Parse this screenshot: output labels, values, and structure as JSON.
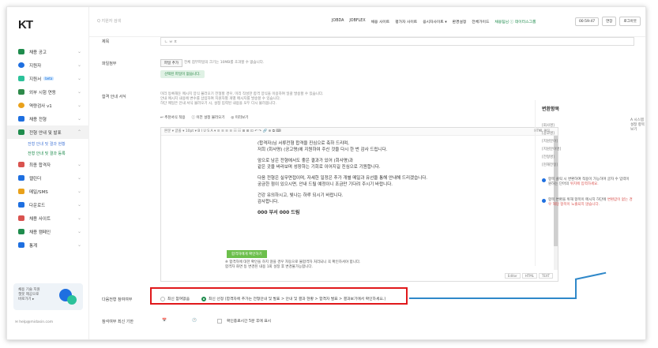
{
  "logo": "KT",
  "search": {
    "placeholder": "Q 지원자 검색"
  },
  "topnav": [
    "JOBDA",
    "JOBFLEX",
    "채용 사이트",
    "평가자 사이트",
    "응시자사이트 ▾",
    "환경설정",
    "전체가이드",
    "채용팀님 ⓘ 데이터스그룹"
  ],
  "top_right": {
    "timer": "00:59:47",
    "extend": "연장",
    "logout": "로그아웃"
  },
  "sidebar": {
    "items": [
      {
        "label": "채용 공고",
        "color": "#1f8c4d"
      },
      {
        "label": "지원자",
        "color": "#1e6fe0"
      },
      {
        "label": "지원서 ",
        "badge": "beta",
        "color": "#2cc29a"
      },
      {
        "label": "외부 시험 연동",
        "color": "#2e8a4a"
      },
      {
        "label": "역량검사 v1",
        "color": "#e9a11b"
      },
      {
        "label": "채용 전형",
        "color": "#1e6fe0"
      },
      {
        "label": "전형 안내 및 발표",
        "color": "#1f8c4d"
      },
      {
        "label": "최종 합격자",
        "color": "#d9534f"
      },
      {
        "label": "캘린더",
        "color": "#1e6fe0"
      },
      {
        "label": "메일/SMS",
        "color": "#e9a11b"
      },
      {
        "label": "다운로드",
        "color": "#1e6fe0"
      },
      {
        "label": "채용 사이트",
        "color": "#d9534f"
      },
      {
        "label": "채용 캠페인",
        "color": "#1f8c4d"
      },
      {
        "label": "통계",
        "color": "#1e6fe0"
      }
    ],
    "sub_items": [
      "전형 안내 및 결과 현황",
      "전형 안내 및 결과 등록"
    ],
    "promo": "채용 기술 지원\n챗봇 제공으로\n바로가기 ▸",
    "footer": "✉ help@midasin.com"
  },
  "form": {
    "title_label": "제목",
    "title_value": "ㄴ ㅂ ㅍ",
    "file_label": "파일첨부",
    "file_button": "파일 추가",
    "file_hint": "전체 첨부파일의 크기는 10MB를 초과할 수 없습니다.",
    "file_none": "선택된 파일이 없습니다.",
    "notice_label": "합격 안내 서식",
    "notice_hint1": "미리 등록해둔 메시지 양식 불러오기 전형할 경우, 미리 작성한 합격 양식을 이용하여 일괄 발송할 수 있습니다.",
    "notice_hint2": "안내 메시지 내용에 변수를 삽입하여 지원자별 개별 메시지를 발송할 수 있습니다.",
    "notice_hint3": "하단 메일은 안내 서식 불러오기 시, 설정 입력된 내용을 모두 다시 불러옵니다.",
    "tool_buttons": [
      "↩ 추천서식 적용",
      "ⓘ 이전 설정 불러오기",
      "◎ 미리보기"
    ],
    "system_setting": "A 시스템 설정 항목 보기",
    "editor_tools": "본문 ▾ 글꼴 ▾ 10pt ▾  B  I  U  S  A  ▾  ≡  ≡  ≡  ≡  ☷  ☷  ⊞  ⊞  ⊡  ↶  ↷  🔗  ⊕  ⧉  ⌨",
    "editor_html": "HTML 편집",
    "body_lines": [
      "(합격자)님 서류전형 합격을 진심으로 축하 드리며,",
      "저희 (회사명) (공고명)에 지원하여 주신 것을 다시 한 번 감사 드립니다.",
      "앞으로 남은 전형에서도 좋은 결과가 있어 (회사명)과",
      "같은 곳을 바라보며 성장하는 기회로 이어지길 진심으로 기원합니다.",
      "다음 전형은 실무면접이며, 자세한 일정은 추가 개별 메일과 유선을 통해 안내해 드리겠습니다.",
      "궁금한 점이 있으시면, 안내 드릴 예정이니 조금만 기다려 주시기 바랍니다.",
      "건강 유의하시고, 빛나는 하루 되시기 바랍니다.",
      "감사합니다."
    ],
    "signature": "000 부서 000 드림",
    "editor_footer": [
      "Editor",
      "HTML",
      "TEXT"
    ],
    "apply_button": "합격자에게 확인하기",
    "apply_note1": "※ 합격자에 대한 확인을 하지 않을 경우 자동으로 불합격자 처리되니 꼭 확인하셔야 합니다.",
    "apply_note2": "합격자 화면 등 변경된 내용 1회 설정 후 변경불가능합니다."
  },
  "right_panel": {
    "title": "변환항목",
    "items": [
      "[회사명]",
      "[공고명]",
      "[지원분야]",
      "[지원분야명]",
      "[전형명]",
      "[현재전형]"
    ],
    "note1_a": "항목 클릭 시 변환하여 적용이 가능하며 글자 수 입력이 원하는 단어의 ",
    "note1_b": "위치에 입력하세요.",
    "note2_a": "항목 변환을 위해 항목이 메시지 하단에 ",
    "note2_b": "변환값이 없는 경우 해당 항목이 노출되지 않습니다."
  },
  "next_step": {
    "label": "다음전형 참여여부",
    "opt1": "최신 참여없음",
    "opt2": "최신 선정 (합격자에 추가는 전형안내 및 발표 > 안내 및 결과 현황 > 합격자 발표 > 결과보기에서 확인하세요.)"
  },
  "deadline": {
    "label": "참석여부 최신 기한",
    "date_icon": "📅",
    "time_icon": "🕐",
    "checkbox_label": "확인종료시간 5분 후에 표시"
  }
}
